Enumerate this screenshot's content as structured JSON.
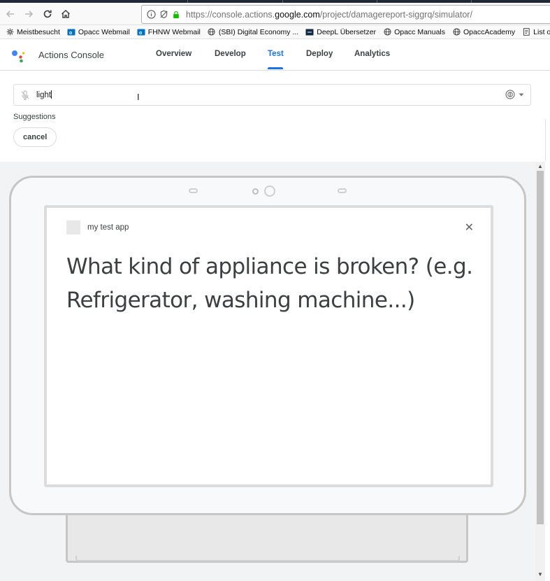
{
  "browser": {
    "url_prefix": "https://console.actions.",
    "url_domain": "google.com",
    "url_suffix": "/project/damagereport-siggrq/simulator/",
    "bookmarks": [
      {
        "label": "Meistbesucht",
        "icon": "gear-icon"
      },
      {
        "label": "Opacc Webmail",
        "icon": "outlook-icon"
      },
      {
        "label": "FHNW Webmail",
        "icon": "outlook-icon"
      },
      {
        "label": "(SBI) Digital Economy ...",
        "icon": "globe-icon"
      },
      {
        "label": "DeepL Übersetzer",
        "icon": "deepl-icon"
      },
      {
        "label": "Opacc Manuals",
        "icon": "globe-icon"
      },
      {
        "label": "OpaccAcademy",
        "icon": "globe-icon"
      },
      {
        "label": "List of SQL Com",
        "icon": "page-icon"
      }
    ]
  },
  "header": {
    "app_title": "Actions Console",
    "tabs": [
      {
        "label": "Overview",
        "active": false
      },
      {
        "label": "Develop",
        "active": false
      },
      {
        "label": "Test",
        "active": true
      },
      {
        "label": "Deploy",
        "active": false
      },
      {
        "label": "Analytics",
        "active": false
      }
    ],
    "accent_color": "#1a73e8"
  },
  "input": {
    "value": "light"
  },
  "suggestions": {
    "label": "Suggestions",
    "chips": [
      "cancel"
    ]
  },
  "display": {
    "app_name": "my test app",
    "prompt": "What kind of appliance is broken? (e.g. Refrigerator, washing machine...)"
  }
}
